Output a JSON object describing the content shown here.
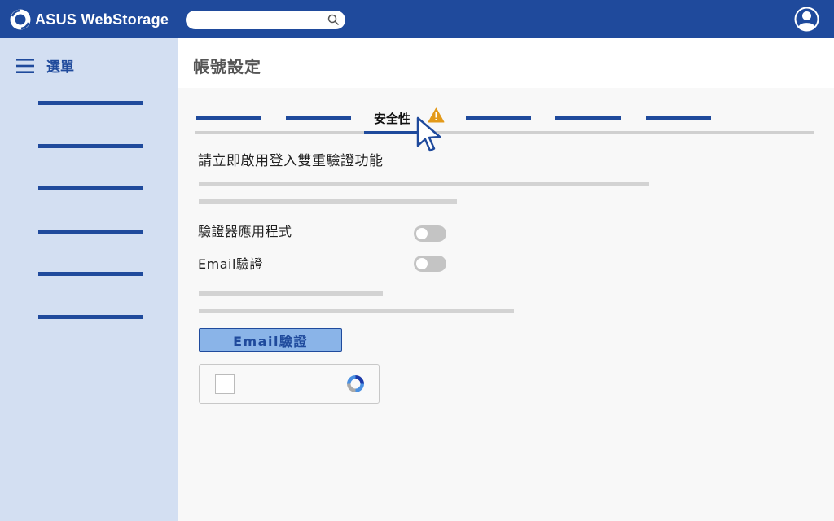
{
  "app": {
    "name": "ASUS WebStorage"
  },
  "search": {
    "placeholder": ""
  },
  "sidebar": {
    "menu_label": "選單",
    "items": [
      "",
      "",
      "",
      "",
      "",
      ""
    ]
  },
  "header": {
    "title": "帳號設定"
  },
  "tabs": {
    "items": [
      "",
      "",
      "安全性",
      "",
      "",
      ""
    ],
    "active_index": 2,
    "warning_icon": "warning-icon"
  },
  "security": {
    "title": "請立即啟用登入雙重驗證功能",
    "options": [
      {
        "label": "驗證器應用程式",
        "enabled": false
      },
      {
        "label": "Email驗證",
        "enabled": false
      }
    ],
    "email_button_label": "Email驗證",
    "captcha_checked": false
  },
  "colors": {
    "brand": "#1f4a9c",
    "sidebar_bg": "#d3dff2",
    "button_bg": "#8ab4e8",
    "warning": "#e39a1a",
    "toggle_off": "#c4c4c4"
  },
  "icons": [
    "logo-icon",
    "search-icon",
    "user-avatar-icon",
    "hamburger-icon",
    "warning-icon",
    "cursor-icon",
    "recaptcha-icon"
  ]
}
